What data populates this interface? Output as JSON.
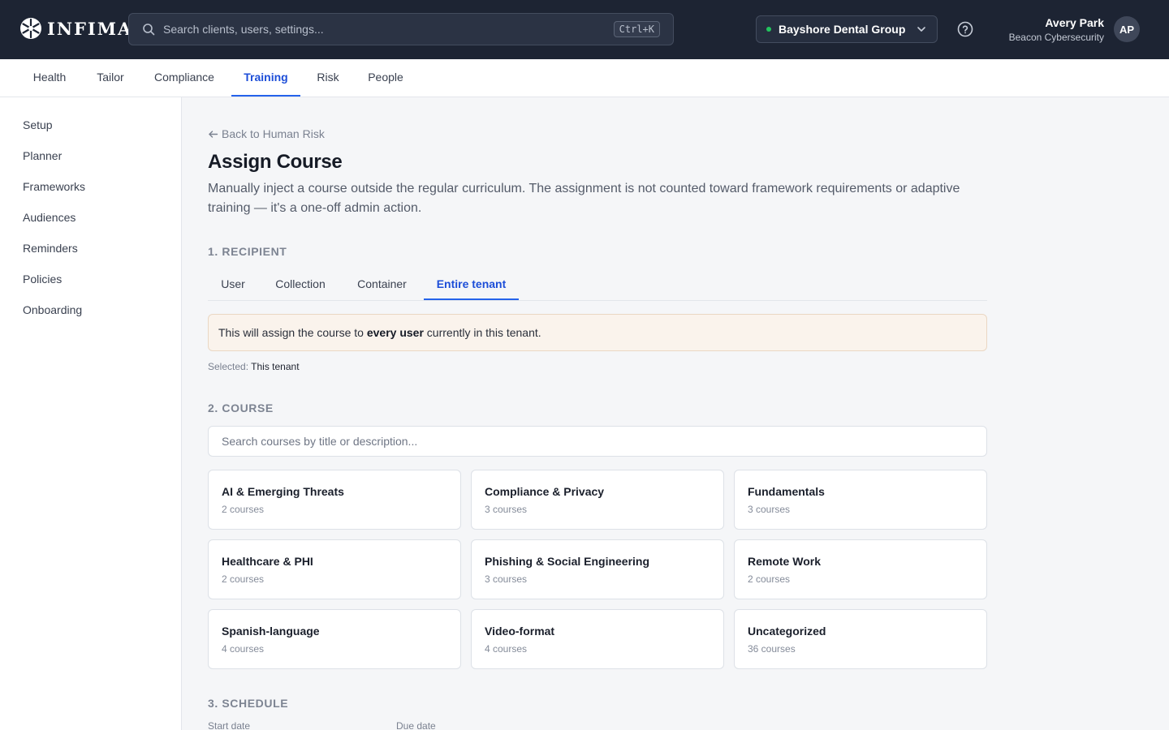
{
  "brand": {
    "name": "INFIMA"
  },
  "search": {
    "placeholder": "Search clients, users, settings...",
    "shortcut": "Ctrl+K"
  },
  "tenant": {
    "name": "Bayshore Dental Group",
    "status_color": "#22c55e"
  },
  "user": {
    "name": "Avery Park",
    "org": "Beacon Cybersecurity",
    "initials": "AP"
  },
  "nav": {
    "tabs": [
      {
        "label": "Health"
      },
      {
        "label": "Tailor"
      },
      {
        "label": "Compliance"
      },
      {
        "label": "Training",
        "active": true
      },
      {
        "label": "Risk"
      },
      {
        "label": "People"
      }
    ]
  },
  "sidebar": {
    "items": [
      {
        "label": "Setup"
      },
      {
        "label": "Planner"
      },
      {
        "label": "Frameworks"
      },
      {
        "label": "Audiences"
      },
      {
        "label": "Reminders"
      },
      {
        "label": "Policies"
      },
      {
        "label": "Onboarding"
      }
    ]
  },
  "page": {
    "back_label": "Back to Human Risk",
    "title": "Assign Course",
    "description": "Manually inject a course outside the regular curriculum. The assignment is not counted toward framework requirements or adaptive training — it's a one-off admin action."
  },
  "recipient": {
    "section_label": "1. RECIPIENT",
    "tabs": [
      {
        "label": "User"
      },
      {
        "label": "Collection"
      },
      {
        "label": "Container"
      },
      {
        "label": "Entire tenant",
        "active": true
      }
    ],
    "notice_pre": "This will assign the course to ",
    "notice_bold": "every user",
    "notice_post": " currently in this tenant.",
    "selected_label": "Selected:",
    "selected_value": "This tenant"
  },
  "course": {
    "section_label": "2. COURSE",
    "search_placeholder": "Search courses by title or description...",
    "categories": [
      {
        "title": "AI & Emerging Threats",
        "count": "2 courses"
      },
      {
        "title": "Compliance & Privacy",
        "count": "3 courses"
      },
      {
        "title": "Fundamentals",
        "count": "3 courses"
      },
      {
        "title": "Healthcare & PHI",
        "count": "2 courses"
      },
      {
        "title": "Phishing & Social Engineering",
        "count": "3 courses"
      },
      {
        "title": "Remote Work",
        "count": "2 courses"
      },
      {
        "title": "Spanish-language",
        "count": "4 courses"
      },
      {
        "title": "Video-format",
        "count": "4 courses"
      },
      {
        "title": "Uncategorized",
        "count": "36 courses"
      }
    ]
  },
  "schedule": {
    "section_label": "3. SCHEDULE",
    "start_label": "Start date",
    "due_label": "Due date"
  },
  "colors": {
    "accent": "#2563eb",
    "topbar": "#1d2433",
    "notice_bg": "#faf3ec"
  }
}
